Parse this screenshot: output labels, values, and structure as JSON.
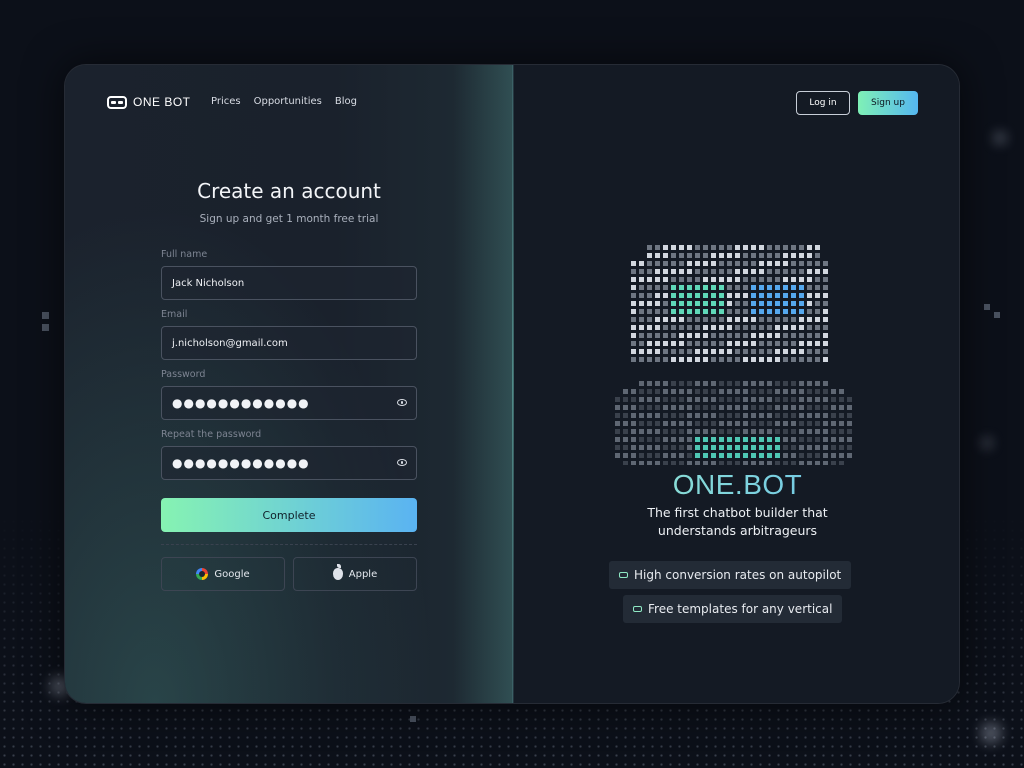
{
  "header": {
    "logo_text": "ONE BOT",
    "nav": [
      "Prices",
      "Opportunities",
      "Blog"
    ],
    "login_label": "Log in",
    "signup_label": "Sign up"
  },
  "form": {
    "title": "Create an account",
    "subtitle": "Sign up and get 1 month free trial",
    "full_name_label": "Full name",
    "full_name_value": "Jack Nicholson",
    "email_label": "Email",
    "email_value": "j.nicholson@gmail.com",
    "password_label": "Password",
    "password_value": "●●●●●●●●●●●●",
    "repeat_label": "Repeat the password",
    "repeat_value": "●●●●●●●●●●●●",
    "complete_label": "Complete",
    "google_label": "Google",
    "apple_label": "Apple"
  },
  "promo": {
    "brand": "ONE.BOT",
    "tagline_line1": "The first chatbot builder that",
    "tagline_line2": "understands arbitrageurs",
    "features": [
      "High conversion rates on autopilot",
      "Free templates for any vertical"
    ]
  },
  "icons": {
    "logo": "robot-mask-icon",
    "password_toggle": "eye-icon",
    "google": "google-icon",
    "apple": "apple-icon",
    "feature": "chat-bubble-icon"
  },
  "colors": {
    "background": "#0c1019",
    "accent_start": "#86f3b2",
    "accent_end": "#5ab3f2"
  }
}
